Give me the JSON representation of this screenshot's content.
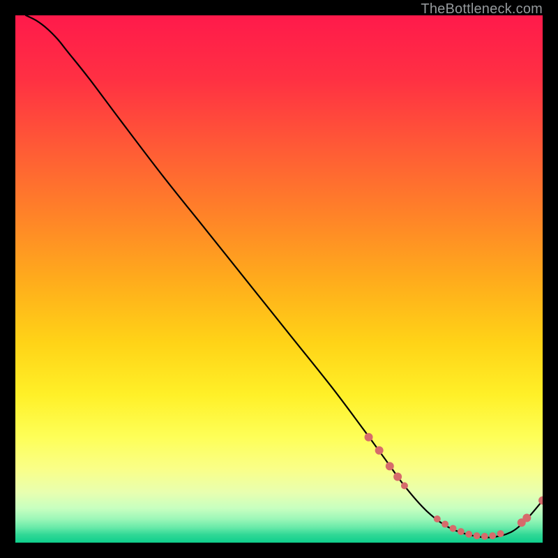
{
  "attribution": "TheBottleneck.com",
  "chart_data": {
    "type": "line",
    "title": "",
    "xlabel": "",
    "ylabel": "",
    "xlim": [
      0,
      100
    ],
    "ylim": [
      0,
      100
    ],
    "series": [
      {
        "name": "curve",
        "x": [
          2,
          4,
          6,
          8,
          10,
          14,
          20,
          28,
          36,
          44,
          52,
          60,
          66,
          70,
          74,
          78,
          82,
          86,
          90,
          94,
          97,
          100
        ],
        "y": [
          100,
          99,
          97.5,
          95.5,
          93,
          88,
          80,
          69.5,
          59.5,
          49.5,
          39.5,
          29.5,
          21.5,
          16,
          10.5,
          6,
          3,
          1.5,
          1,
          2,
          4.5,
          8
        ]
      }
    ],
    "markers": {
      "name": "highlight-dots",
      "color": "#d66b6b",
      "points": [
        {
          "x": 67,
          "y": 20,
          "r": 6
        },
        {
          "x": 69,
          "y": 17.5,
          "r": 6
        },
        {
          "x": 71,
          "y": 14.5,
          "r": 6
        },
        {
          "x": 72.5,
          "y": 12.5,
          "r": 6
        },
        {
          "x": 73.8,
          "y": 10.8,
          "r": 5
        },
        {
          "x": 80,
          "y": 4.5,
          "r": 5
        },
        {
          "x": 81.5,
          "y": 3.5,
          "r": 5
        },
        {
          "x": 83,
          "y": 2.7,
          "r": 5
        },
        {
          "x": 84.5,
          "y": 2.1,
          "r": 5
        },
        {
          "x": 86,
          "y": 1.6,
          "r": 5
        },
        {
          "x": 87.5,
          "y": 1.3,
          "r": 5
        },
        {
          "x": 89,
          "y": 1.2,
          "r": 5
        },
        {
          "x": 90.5,
          "y": 1.3,
          "r": 5
        },
        {
          "x": 92,
          "y": 1.7,
          "r": 5
        },
        {
          "x": 96,
          "y": 3.8,
          "r": 6
        },
        {
          "x": 97,
          "y": 4.7,
          "r": 6
        },
        {
          "x": 100,
          "y": 8,
          "r": 6
        }
      ]
    },
    "gradient_stops": [
      {
        "offset": 0.0,
        "color": "#ff1a4b"
      },
      {
        "offset": 0.12,
        "color": "#ff3043"
      },
      {
        "offset": 0.25,
        "color": "#ff5a36"
      },
      {
        "offset": 0.38,
        "color": "#ff8328"
      },
      {
        "offset": 0.5,
        "color": "#ffab1c"
      },
      {
        "offset": 0.62,
        "color": "#ffd317"
      },
      {
        "offset": 0.72,
        "color": "#fff028"
      },
      {
        "offset": 0.8,
        "color": "#feff58"
      },
      {
        "offset": 0.86,
        "color": "#faff88"
      },
      {
        "offset": 0.905,
        "color": "#e8ffb0"
      },
      {
        "offset": 0.935,
        "color": "#c7ffc0"
      },
      {
        "offset": 0.955,
        "color": "#9cf7b8"
      },
      {
        "offset": 0.972,
        "color": "#66e9a8"
      },
      {
        "offset": 0.985,
        "color": "#30d896"
      },
      {
        "offset": 1.0,
        "color": "#0fcf8c"
      }
    ]
  }
}
